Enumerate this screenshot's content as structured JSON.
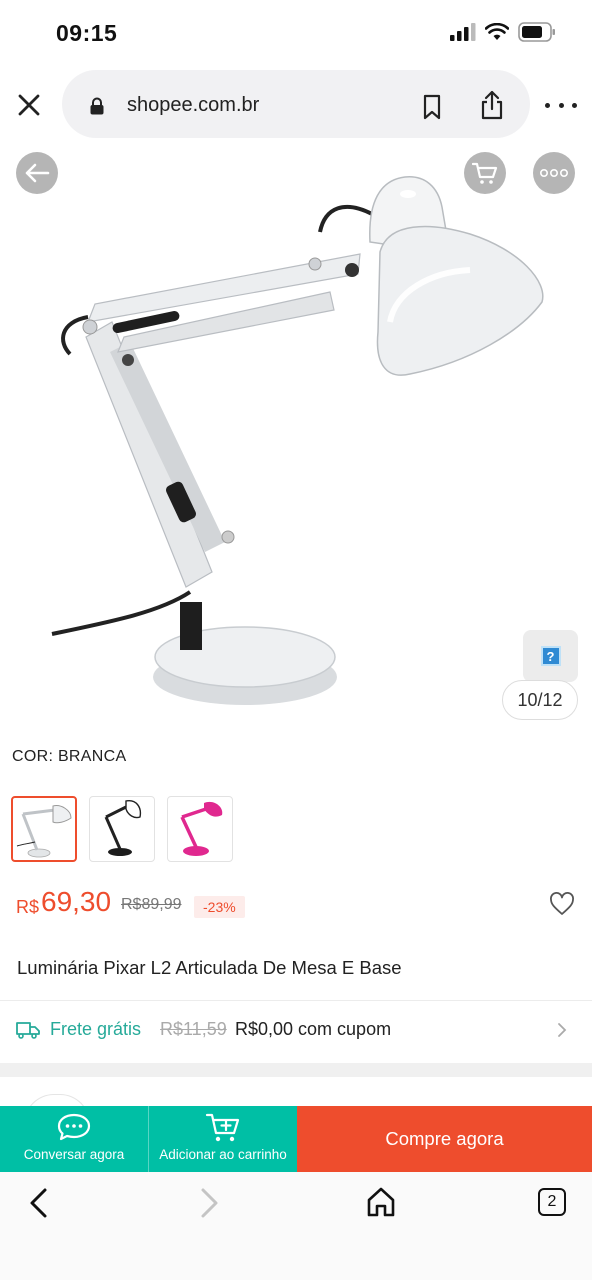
{
  "status_bar": {
    "time": "09:15"
  },
  "browser": {
    "url": "shopee.com.br",
    "tab_count": "2"
  },
  "product": {
    "image_counter": "10/12",
    "help_badge": "?",
    "variation_label": "COR: BRANCA",
    "variations": [
      {
        "name": "branca",
        "color": "#e9ecef"
      },
      {
        "name": "preta",
        "color": "#222222"
      },
      {
        "name": "rosa",
        "color": "#e0288f"
      }
    ],
    "price_currency": "R$",
    "price_value": "69,30",
    "price_old": "R$89,99",
    "discount": "-23%",
    "title": "Luminária Pixar L2 Articulada De Mesa E Base"
  },
  "shipping": {
    "free_label": "Frete grátis",
    "old_price": "R$11,59",
    "new_price": "R$0,00 com cupom"
  },
  "actions": {
    "chat_label": "Conversar agora",
    "cart_label": "Adicionar ao carrinho",
    "buy_label": "Compre agora"
  },
  "colors": {
    "brand": "#ee4d2d",
    "teal": "#00bfa5",
    "ship_green": "#26aa99"
  }
}
